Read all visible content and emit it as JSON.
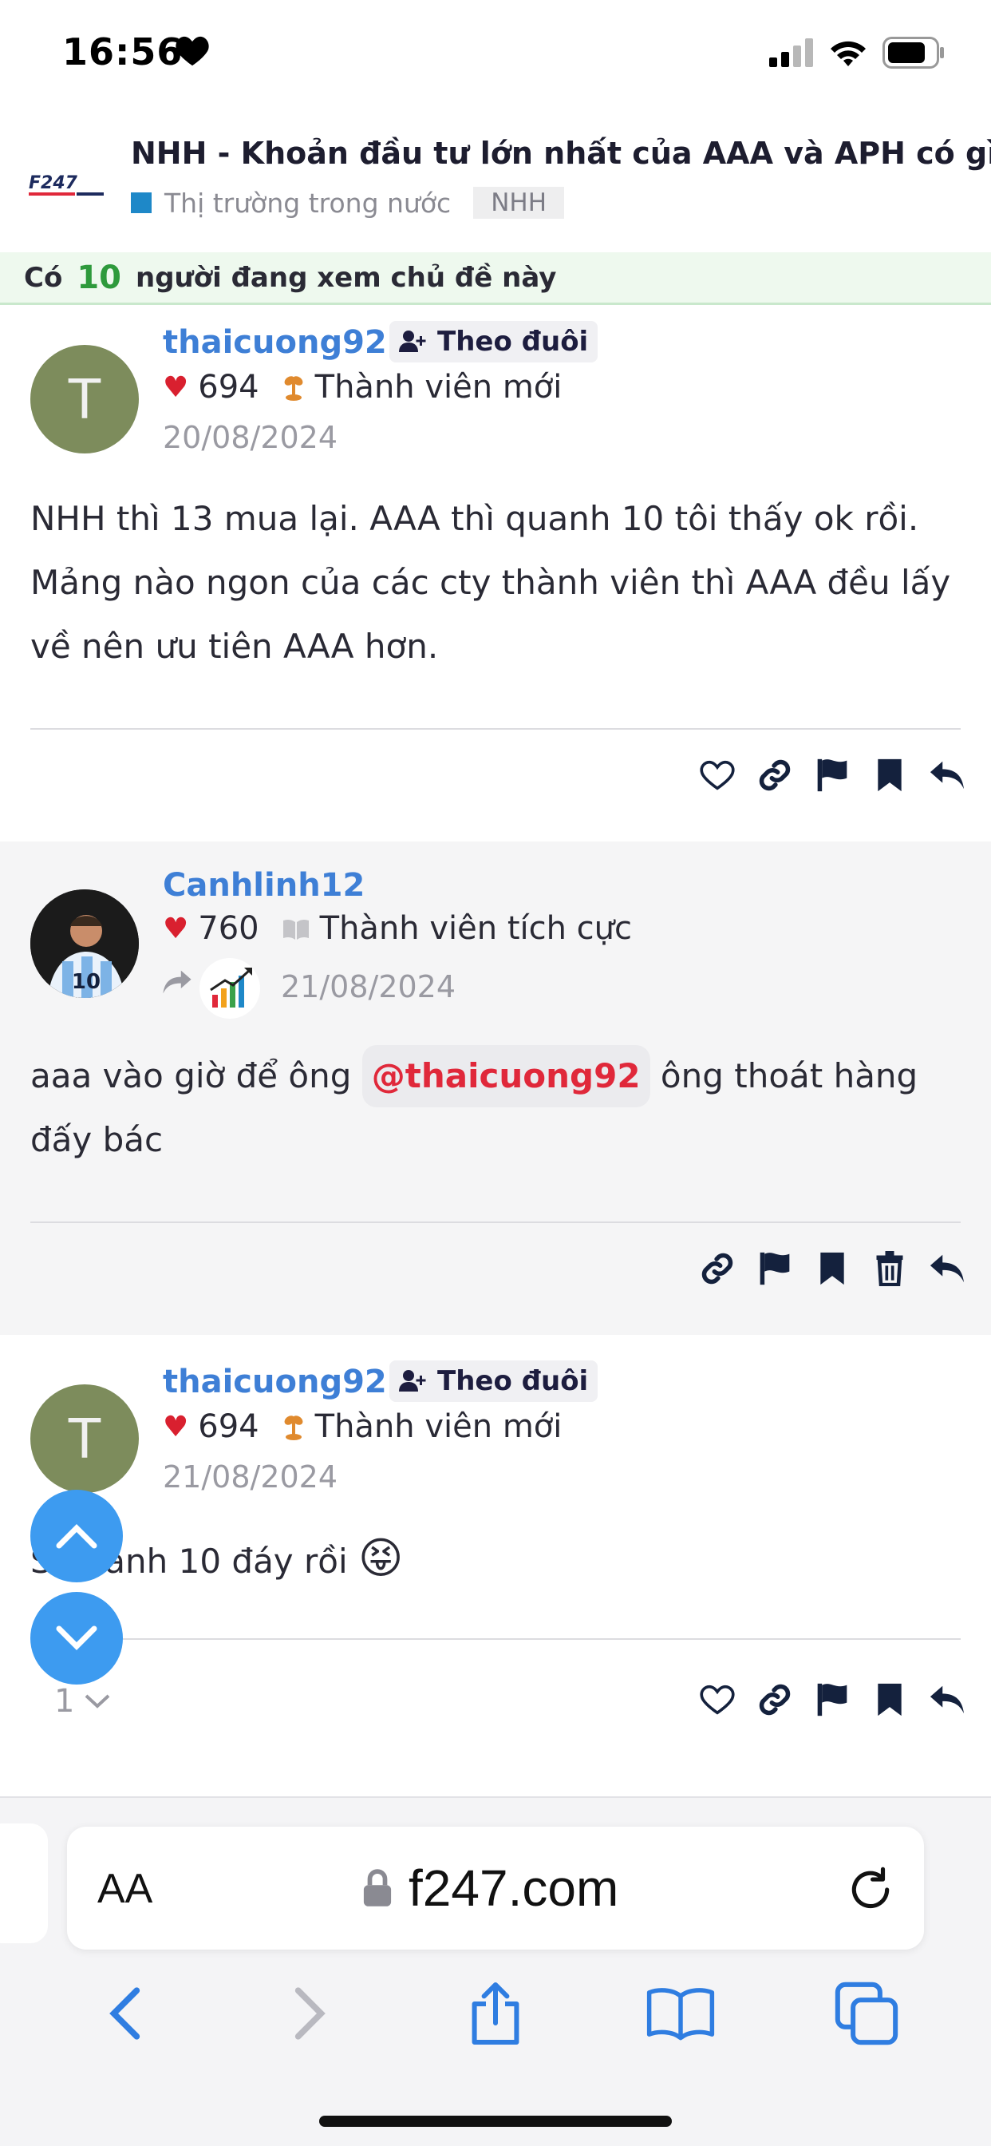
{
  "status_bar": {
    "time": "16:56"
  },
  "thread": {
    "logo_text": "F247",
    "title": "NHH - Khoản đầu tư lớn nhất của AAA và APH có gì!",
    "category": "Thị trường trong nước",
    "tag": "NHH"
  },
  "viewers": {
    "prefix": "Có",
    "count": "10",
    "suffix": "người đang xem chủ đề này"
  },
  "posts": [
    {
      "avatar_letter": "T",
      "username": "thaicuong92",
      "follow_label": "Theo đuôi",
      "likes": "694",
      "rank": "Thành viên mới",
      "date": "20/08/2024",
      "content": "NHH thì 13 mua lại. AAA thì quanh 10 tôi thấy ok rồi. Mảng nào ngon của các cty thành viên thì AAA đều lấy về nên ưu tiên AAA hơn."
    },
    {
      "username": "Canhlinh12",
      "likes": "760",
      "rank": "Thành viên tích cực",
      "date": "21/08/2024",
      "content_before": "aaa vào giờ để ông",
      "mention": "@thaicuong92",
      "content_after": "ông thoát hàng đấy bác"
    },
    {
      "avatar_letter": "T",
      "username": "thaicuong92",
      "follow_label": "Theo đuôi",
      "likes": "694",
      "rank": "Thành viên mới",
      "date": "21/08/2024",
      "content": "S quanh 10 đáy rồi",
      "emoji": "😝",
      "reaction_count": "1"
    }
  ],
  "browser": {
    "aa_label": "AA",
    "url": "f247.com"
  },
  "colors": {
    "accent": "#3e7fd6",
    "like": "#d9202f",
    "mention": "#e0283a",
    "fab": "#3d9bf0",
    "icon_navy": "#14213d"
  }
}
